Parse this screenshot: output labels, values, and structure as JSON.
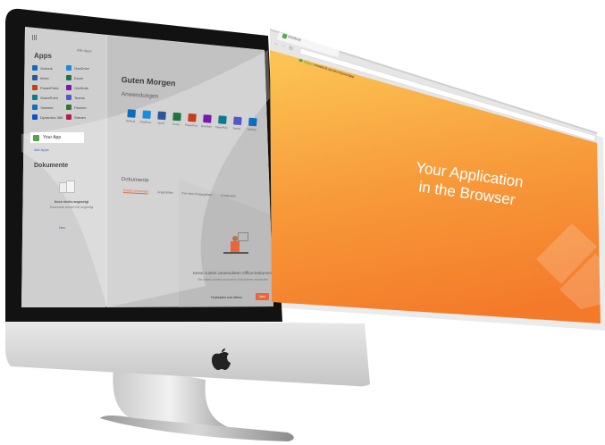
{
  "office": {
    "apps_heading": "Apps",
    "apps_link": "Alle Apps",
    "app_labels": [
      "Outlook",
      "OneDrive",
      "Word",
      "Excel",
      "PowerPoint",
      "OneNote",
      "SharePoint",
      "Teams",
      "Yammer",
      "Planner",
      "Dynamics 365",
      "Stream"
    ],
    "your_app_label": "Your App",
    "more_apps": "Alle Apps",
    "greeting": "Guten Morgen",
    "section_apps": "Anwendungen",
    "section_documents_sidebar": "Dokumente",
    "docs_empty_title": "Noch nichts angezeigt",
    "docs_empty_text": "Dokumente werden hier angezeigt",
    "docs_button": "Neu",
    "section_documents_main": "Dokumente",
    "tabs": [
      "Zuletzt verwendet",
      "Angeheftet",
      "Für mich freigegeben",
      "Entdecken"
    ],
    "empty_heading": "Keine zuletzt verwendeten Office-Dokumente",
    "empty_text": "Sie haben zuletzt noch keine Dokumente verwendet.",
    "upload_label": "Hochladen und öffnen",
    "new_label": "Neu"
  },
  "browser": {
    "tab_title": "onedock",
    "url_secure": "https://",
    "url_rest": "onedock.services/yourapp",
    "headline_line1": "Your Application",
    "headline_line2": "in the Browser"
  },
  "colors": {
    "orange_top": "#fcc253",
    "orange_mid": "#f79a3a",
    "orange_bottom": "#f47a2a",
    "accent_red": "#e8663a",
    "office_bg": "#e9e9e9",
    "office_sidebar": "#d7d7d7"
  },
  "icons": {
    "apple": "apple-logo-icon",
    "back": "back-arrow-icon",
    "forward": "forward-arrow-icon",
    "reload": "reload-icon",
    "tab_favicon": "onedock-favicon-icon",
    "secure": "lock-icon",
    "waffle": "waffle-menu-icon",
    "watermark": "onedock-logo-watermark"
  }
}
